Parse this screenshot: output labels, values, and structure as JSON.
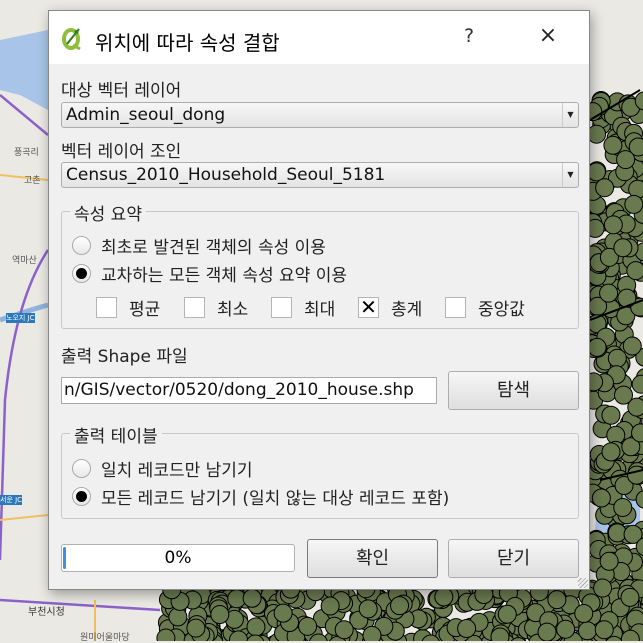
{
  "map": {
    "labels": [
      "풍곡리",
      "고촌",
      "역마산",
      "노오지 JC",
      "서운 JC",
      "부천시청",
      "원미어울마당"
    ],
    "point_color": "#6a7a4f",
    "water_color": "#a8c4e8",
    "road_color": "#8b62c9"
  },
  "dialog": {
    "title": "위치에 따라 속성 결합",
    "help_label": "?",
    "close_label": "×",
    "target_layer": {
      "label": "대상 벡터 레이어",
      "value": "Admin_seoul_dong"
    },
    "join_layer": {
      "label": "벡터 레이어 조인",
      "value": "Census_2010_Household_Seoul_5181"
    },
    "attribute_summary": {
      "title": "속성 요약",
      "options": [
        {
          "label": "최초로 발견된 객체의 속성 이용",
          "selected": false
        },
        {
          "label": "교차하는 모든 객체 속성 요약 이용",
          "selected": true
        }
      ],
      "stats": [
        {
          "label": "평균",
          "checked": false
        },
        {
          "label": "최소",
          "checked": false
        },
        {
          "label": "최대",
          "checked": false
        },
        {
          "label": "총계",
          "checked": true
        },
        {
          "label": "중앙값",
          "checked": false
        }
      ],
      "check_mark": "✕"
    },
    "output_shape": {
      "label": "출력 Shape 파일",
      "value": "n/GIS/vector/0520/dong_2010_house.shp",
      "browse_label": "탐색"
    },
    "output_table": {
      "title": "출력 테이블",
      "options": [
        {
          "label": "일치 레코드만 남기기",
          "selected": false
        },
        {
          "label": "모든 레코드 남기기 (일치 않는 대상 레코드 포함)",
          "selected": true
        }
      ]
    },
    "progress": {
      "text": "0%",
      "value": 0
    },
    "ok_label": "확인",
    "close_button_label": "닫기"
  }
}
